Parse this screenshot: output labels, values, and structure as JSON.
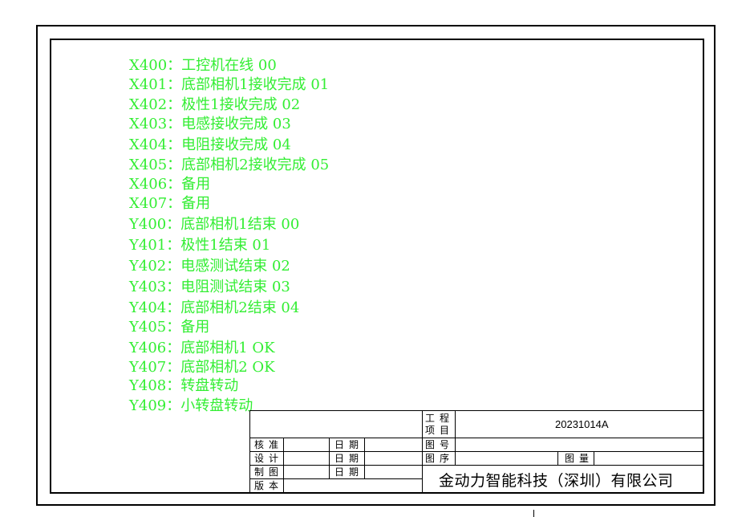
{
  "io_list": [
    {
      "code": "X400：",
      "desc": "工控机在线 00"
    },
    {
      "code": "X401：",
      "desc": "底部相机1接收完成 01"
    },
    {
      "code": "X402：",
      "desc": "极性1接收完成 02"
    },
    {
      "code": "X403：",
      "desc": "电感接收完成 03"
    },
    {
      "code": "X404：",
      "desc": "电阻接收完成 04"
    },
    {
      "code": "X405：",
      "desc": "底部相机2接收完成 05"
    },
    {
      "code": "X406：",
      "desc": "备用"
    },
    {
      "code": "X407：",
      "desc": "备用"
    },
    {
      "code": "Y400：",
      "desc": "底部相机1结束 00"
    },
    {
      "code": "Y401：",
      "desc": "极性1结束 01"
    },
    {
      "code": "Y402：",
      "desc": "电感测试结束 02"
    },
    {
      "code": "Y403：",
      "desc": "电阻测试结束 03"
    },
    {
      "code": "Y404：",
      "desc": "底部相机2结束 04"
    },
    {
      "code": "Y405：",
      "desc": "备用"
    },
    {
      "code": "Y406：",
      "desc": "底部相机1 OK"
    },
    {
      "code": "Y407：",
      "desc": "底部相机2 OK"
    },
    {
      "code": "Y408：",
      "desc": "转盘转动"
    },
    {
      "code": "Y409：",
      "desc": "小转盘转动"
    }
  ],
  "title_block": {
    "project_label_1": "工程",
    "project_label_2": "项目",
    "project_number": "20231014A",
    "review_label": "核准",
    "design_label": "设计",
    "draft_label": "制图",
    "version_label": "版本",
    "date_label": "日期",
    "drawing_no_label": "图号",
    "sequence_label": "图序",
    "quantity_label": "图量",
    "company": "金动力智能科技（深圳）有限公司"
  }
}
